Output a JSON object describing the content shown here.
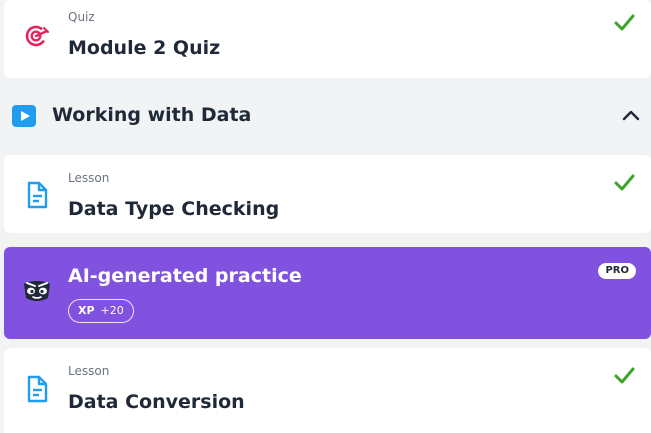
{
  "quiz_item": {
    "type": "Quiz",
    "title": "Module 2 Quiz",
    "icon": "target-icon",
    "completed": true
  },
  "section": {
    "title": "Working with Data",
    "icon": "play-icon",
    "expanded": true
  },
  "items": [
    {
      "type": "Lesson",
      "title": "Data Type Checking",
      "icon": "lesson-document-icon",
      "completed": true
    },
    {
      "title": "AI-generated practice",
      "icon": "mascot-face-icon",
      "xp_label": "XP",
      "xp_value": "+20",
      "badge": "PRO",
      "accent": "#8152e0"
    },
    {
      "type": "Lesson",
      "title": "Data Conversion",
      "icon": "lesson-document-icon",
      "completed": true
    }
  ],
  "colors": {
    "check": "#3ea32c",
    "quiz_icon": "#e0245e",
    "lesson_icon": "#1f9ef0",
    "section_icon": "#1f9ef0"
  }
}
